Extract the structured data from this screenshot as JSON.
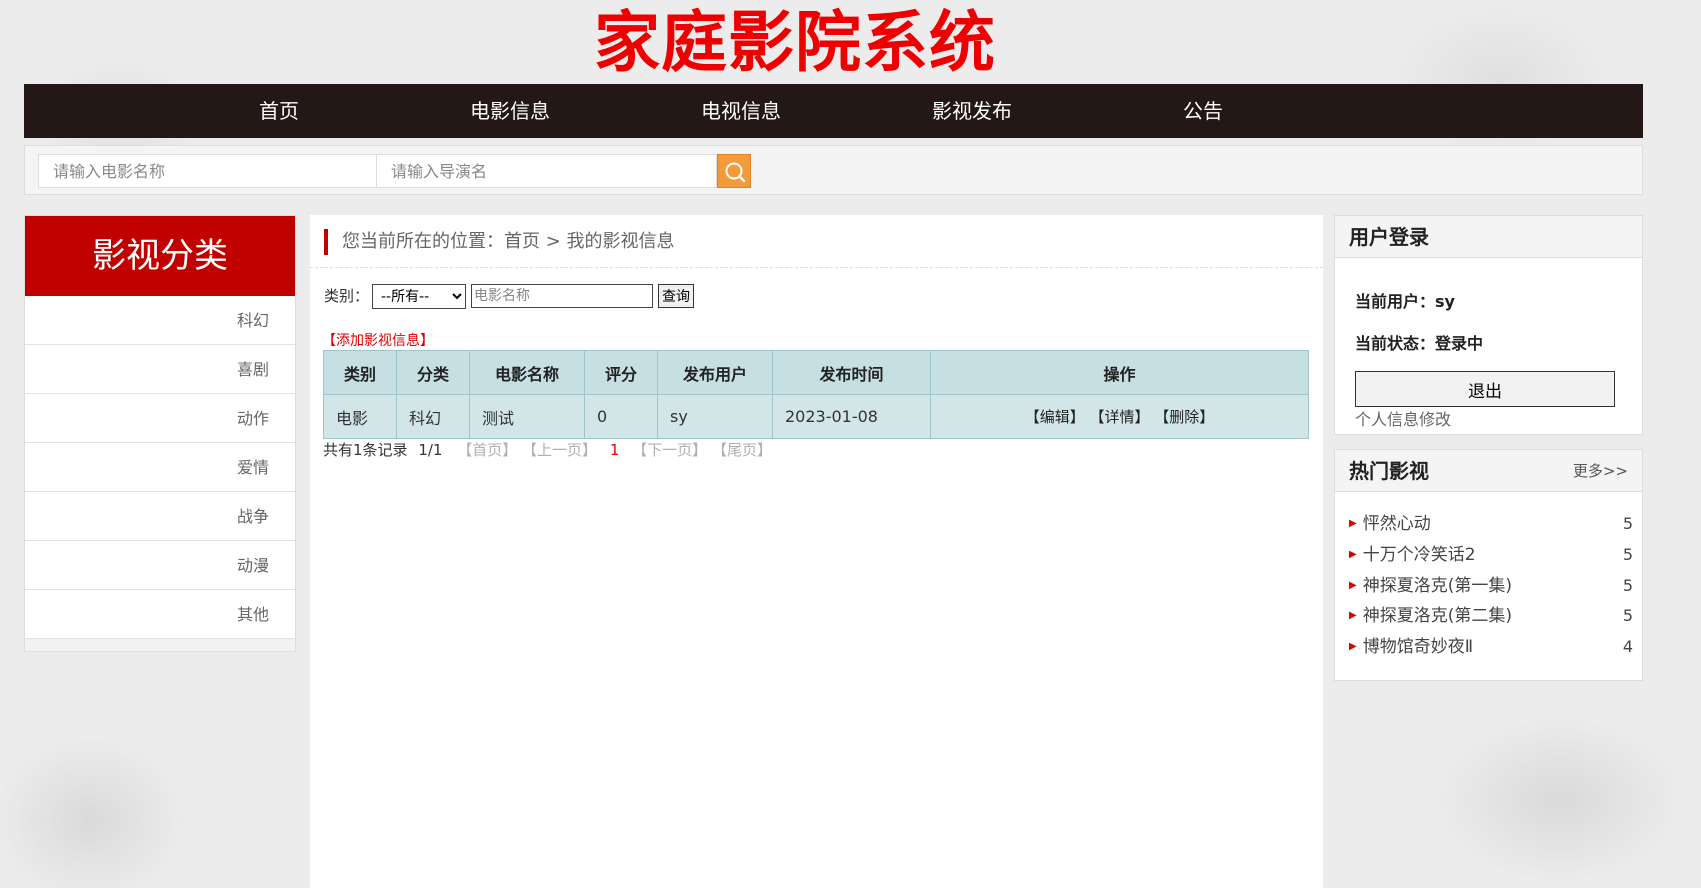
{
  "site": {
    "title": "家庭影院系统"
  },
  "nav": {
    "items": [
      "首页",
      "电影信息",
      "电视信息",
      "影视发布",
      "公告"
    ]
  },
  "search": {
    "movie_placeholder": "请输入电影名称",
    "director_placeholder": "请输入导演名",
    "button_icon": "search-icon"
  },
  "sidebar": {
    "title": "影视分类",
    "categories": [
      "科幻",
      "喜剧",
      "动作",
      "爱情",
      "战争",
      "动漫",
      "其他"
    ]
  },
  "breadcrumb": {
    "text": "您当前所在的位置：首页 > 我的影视信息"
  },
  "filter": {
    "label": "类别：",
    "select_value": "--所有--",
    "name_placeholder": "电影名称",
    "button": "查询"
  },
  "add_link": "【添加影视信息】",
  "table": {
    "headers": [
      "类别",
      "分类",
      "电影名称",
      "评分",
      "发布用户",
      "发布时间",
      "操作"
    ],
    "rows": [
      {
        "type": "电影",
        "category": "科幻",
        "name": "测试",
        "score": "0",
        "user": "sy",
        "time": "2023-01-08",
        "ops": [
          "【编辑】",
          "【详情】",
          "【删除】"
        ]
      }
    ]
  },
  "pager": {
    "summary": "共有1条记录",
    "pages": "1/1",
    "first": "【首页】",
    "prev": "【上一页】",
    "current": "1",
    "next": "【下一页】",
    "last": "【尾页】"
  },
  "login": {
    "title": "用户登录",
    "user_line": "当前用户：sy",
    "status_line": "当前状态：登录中",
    "logout": "退出",
    "profile": "个人信息修改"
  },
  "hot": {
    "title": "热门影视",
    "more": "更多>>",
    "items": [
      {
        "name": "怦然心动",
        "score": "5"
      },
      {
        "name": "十万个冷笑话2",
        "score": "5"
      },
      {
        "name": "神探夏洛克(第一集)",
        "score": "5"
      },
      {
        "name": "神探夏洛克(第二集)",
        "score": "5"
      },
      {
        "name": "博物馆奇妙夜Ⅱ",
        "score": "4"
      }
    ]
  },
  "colors": {
    "title_red": "#ee0000",
    "nav_bg": "#231815",
    "category_head": "#c10000",
    "search_btn": "#f39a3a",
    "table_bg": "#d2e6e8"
  }
}
